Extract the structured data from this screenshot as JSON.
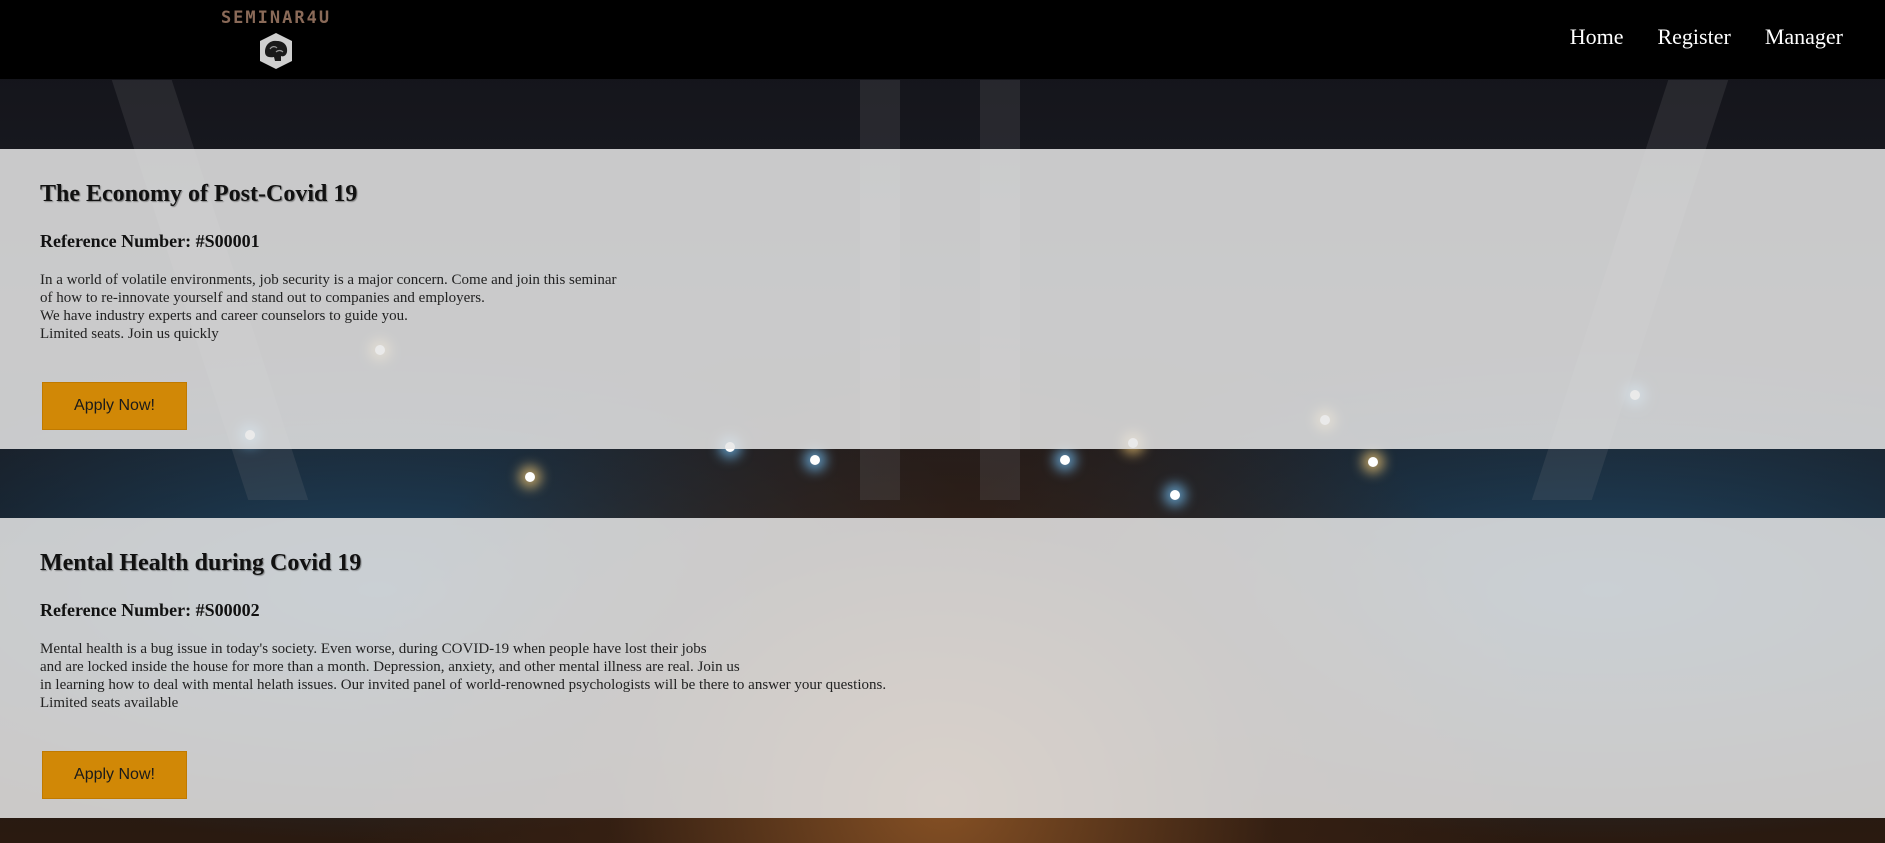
{
  "brand": {
    "logo_text": "SEMINAR4U",
    "logo_icon": "brain-icon"
  },
  "nav": {
    "links": [
      {
        "label": "Home"
      },
      {
        "label": "Register"
      },
      {
        "label": "Manager"
      }
    ]
  },
  "seminars": [
    {
      "title": "The Economy of Post-Covid 19",
      "reference": "Reference Number: #S00001",
      "description": [
        "In a world of volatile environments, job security is a major concern. Come and join this seminar",
        "of how to re-innovate yourself and stand out to companies and employers.",
        "We have industry experts and career counselors to guide you.",
        "Limited seats. Join us quickly"
      ],
      "button_label": "Apply Now!"
    },
    {
      "title": "Mental Health during Covid 19",
      "reference": "Reference Number: #S00002",
      "description": [
        "Mental health is a bug issue in today's society. Even worse, during COVID-19 when people have lost their jobs",
        "and are locked inside the house for more than a month. Depression, anxiety, and other mental illness are real. Join us",
        "in learning how to deal with mental helath issues. Our invited panel of world-renowned psychologists will be there to answer your questions.",
        "Limited seats available"
      ],
      "button_label": "Apply Now!"
    }
  ],
  "colors": {
    "navbar": "#000000",
    "panel": "#e6e6e6",
    "button": "#d18806"
  }
}
